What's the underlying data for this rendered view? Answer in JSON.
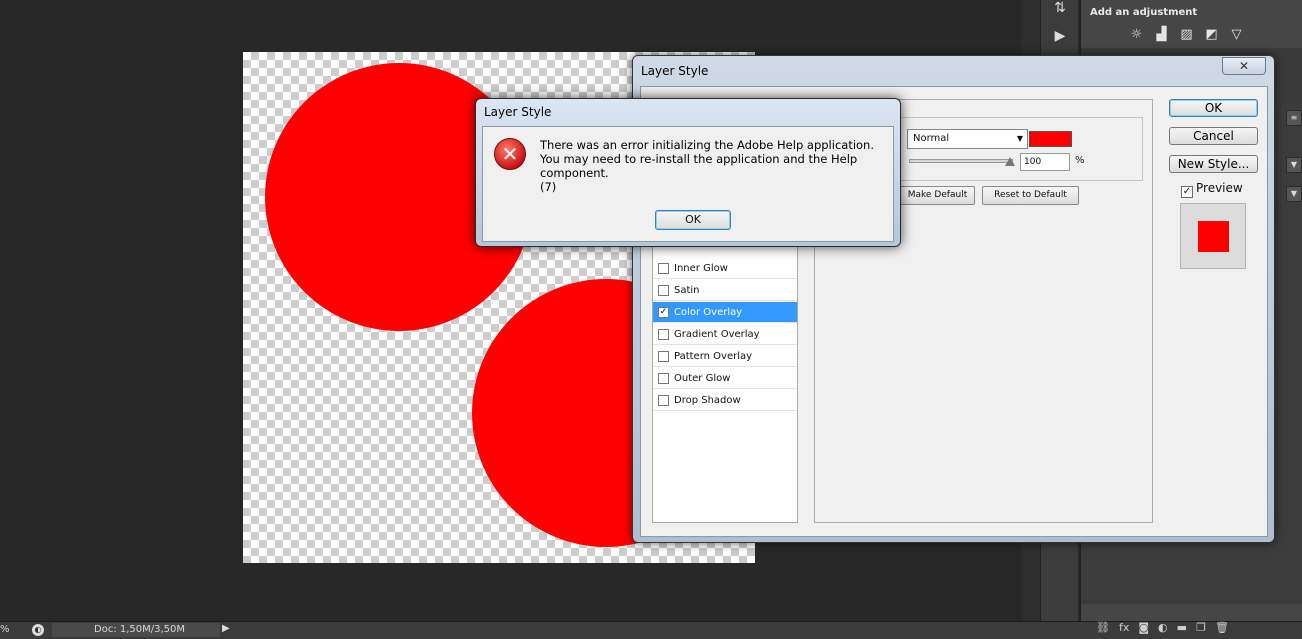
{
  "status_bar": {
    "zoom": "%",
    "doc_info": "Doc: 1,50M/3,50M"
  },
  "adjustments": {
    "title": "Add an adjustment",
    "icons": [
      "brightness-icon",
      "levels-icon",
      "curves-icon",
      "exposure-icon",
      "gradient-map-icon"
    ]
  },
  "layer_style_dialog": {
    "title": "Layer Style",
    "close_label": "✕",
    "style_items": [
      {
        "label": "Inner Glow",
        "checked": false
      },
      {
        "label": "Satin",
        "checked": false
      },
      {
        "label": "Color Overlay",
        "checked": true
      },
      {
        "label": "Gradient Overlay",
        "checked": false
      },
      {
        "label": "Pattern Overlay",
        "checked": false
      },
      {
        "label": "Outer Glow",
        "checked": false
      },
      {
        "label": "Drop Shadow",
        "checked": false
      }
    ],
    "blend_mode": "Normal",
    "overlay_color": "#ff0000",
    "opacity_value": "100",
    "opacity_unit": "%",
    "make_default_label": "Make Default",
    "reset_default_label": "Reset to Default",
    "ok_label": "OK",
    "cancel_label": "Cancel",
    "new_style_label": "New Style...",
    "preview_label": "Preview",
    "preview_checked": true
  },
  "error_dialog": {
    "title": "Layer Style",
    "message": "There was an error initializing the Adobe Help application. You may need to re-install the application and the Help component.",
    "code": "(7)",
    "ok_label": "OK"
  }
}
